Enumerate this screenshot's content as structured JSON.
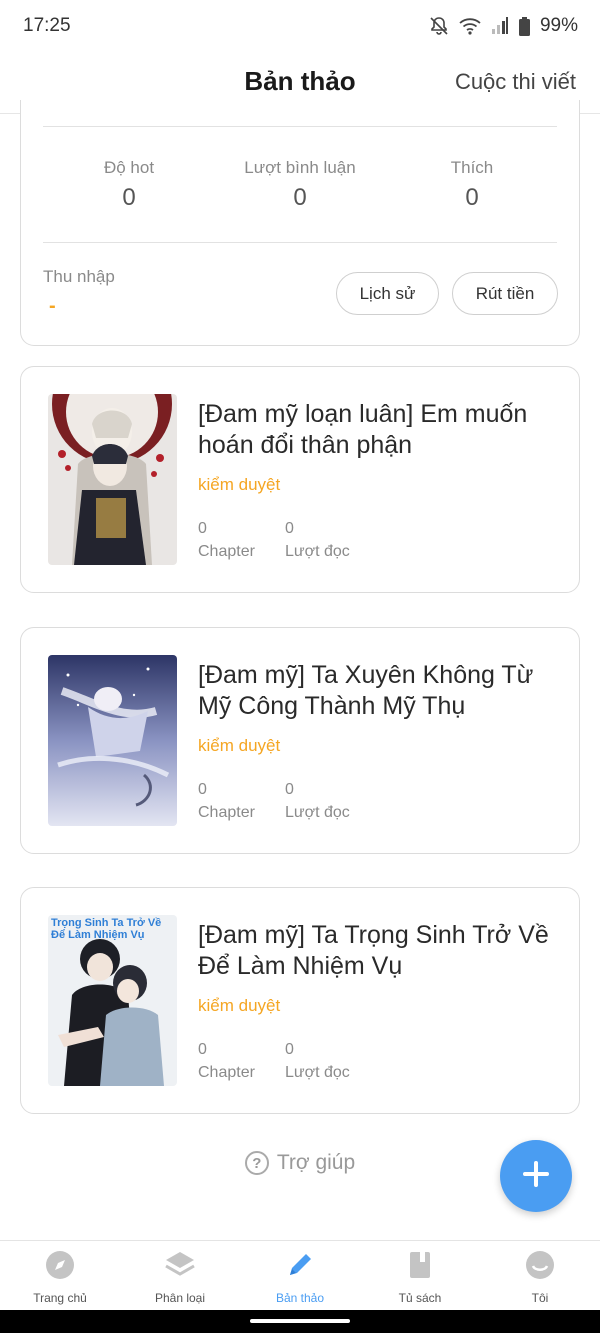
{
  "status_bar": {
    "time": "17:25",
    "battery": "99%"
  },
  "header": {
    "title": "Bản thảo",
    "right_link": "Cuộc thi viết"
  },
  "stats": {
    "items": [
      {
        "label": "Độ hot",
        "value": "0"
      },
      {
        "label": "Lượt bình luận",
        "value": "0"
      },
      {
        "label": "Thích",
        "value": "0"
      }
    ],
    "income_label": "Thu nhập",
    "income_value": "-",
    "history_button": "Lịch sử",
    "withdraw_button": "Rút tiền"
  },
  "books": [
    {
      "title": "[Đam mỹ loạn luân] Em muốn hoán đổi thân phận",
      "status": "kiểm duyệt",
      "chapters": "0",
      "chapters_label": "Chapter",
      "reads": "0",
      "reads_label": "Lượt đọc"
    },
    {
      "title": "[Đam mỹ] Ta Xuyên Không Từ Mỹ Công Thành Mỹ Thụ",
      "status": "kiểm duyệt",
      "chapters": "0",
      "chapters_label": "Chapter",
      "reads": "0",
      "reads_label": "Lượt đọc"
    },
    {
      "title": "[Đam mỹ] Ta Trọng Sinh Trở Về Để Làm Nhiệm Vụ",
      "status": "kiểm duyệt",
      "chapters": "0",
      "chapters_label": "Chapter",
      "reads": "0",
      "reads_label": "Lượt đọc",
      "cover_text": "Trọng Sinh Ta Trở Về Để Làm Nhiệm Vụ"
    }
  ],
  "help_label": "Trợ giúp",
  "fab_icon": "plus-icon",
  "colors": {
    "accent": "#4a9df2",
    "status": "#f5a623"
  },
  "nav": [
    {
      "label": "Trang chủ",
      "icon": "compass-icon"
    },
    {
      "label": "Phân loại",
      "icon": "layers-icon"
    },
    {
      "label": "Bản thảo",
      "icon": "pencil-icon",
      "active": true
    },
    {
      "label": "Tủ sách",
      "icon": "book-icon"
    },
    {
      "label": "Tôi",
      "icon": "smile-icon"
    }
  ]
}
